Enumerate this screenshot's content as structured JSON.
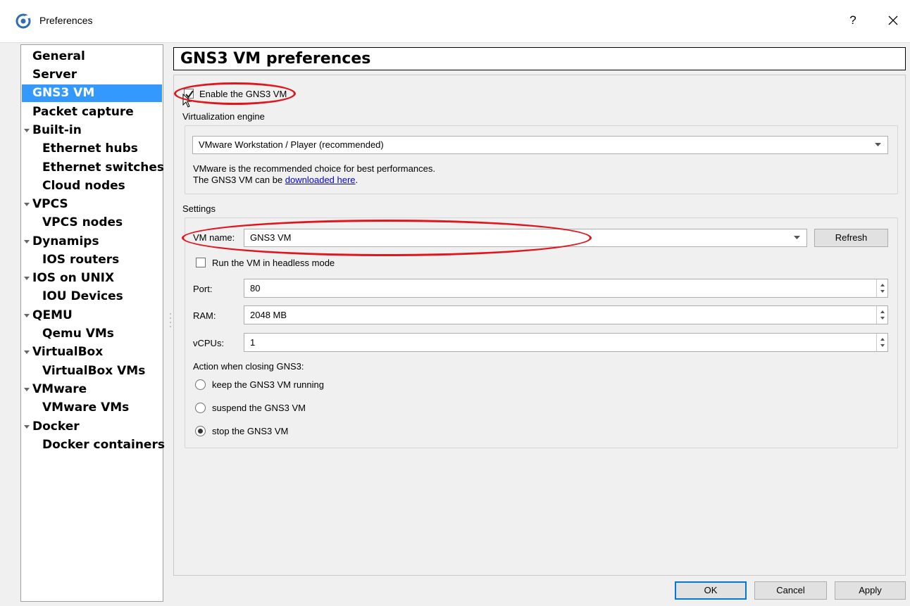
{
  "window": {
    "title": "Preferences",
    "help_label": "?",
    "icon": "gns3-app-icon",
    "close_icon": "close-icon"
  },
  "tree": {
    "items": [
      {
        "label": "General",
        "level": 0
      },
      {
        "label": "Server",
        "level": 0
      },
      {
        "label": "GNS3 VM",
        "level": 0,
        "selected": true
      },
      {
        "label": "Packet capture",
        "level": 0
      },
      {
        "label": "Built-in",
        "level": 0,
        "expanded": true
      },
      {
        "label": "Ethernet hubs",
        "level": 1
      },
      {
        "label": "Ethernet switches",
        "level": 1
      },
      {
        "label": "Cloud nodes",
        "level": 1
      },
      {
        "label": "VPCS",
        "level": 0,
        "expanded": true
      },
      {
        "label": "VPCS nodes",
        "level": 1
      },
      {
        "label": "Dynamips",
        "level": 0,
        "expanded": true
      },
      {
        "label": "IOS routers",
        "level": 1
      },
      {
        "label": "IOS on UNIX",
        "level": 0,
        "expanded": true
      },
      {
        "label": "IOU Devices",
        "level": 1
      },
      {
        "label": "QEMU",
        "level": 0,
        "expanded": true
      },
      {
        "label": "Qemu VMs",
        "level": 1
      },
      {
        "label": "VirtualBox",
        "level": 0,
        "expanded": true
      },
      {
        "label": "VirtualBox VMs",
        "level": 1
      },
      {
        "label": "VMware",
        "level": 0,
        "expanded": true
      },
      {
        "label": "VMware VMs",
        "level": 1
      },
      {
        "label": "Docker",
        "level": 0,
        "expanded": true
      },
      {
        "label": "Docker containers",
        "level": 1
      }
    ]
  },
  "page": {
    "title": "GNS3 VM preferences",
    "enable_label": "Enable the GNS3 VM",
    "enable_checked": true,
    "engine_group_label": "Virtualization engine",
    "engine_value": "VMware Workstation / Player (recommended)",
    "engine_note_line1": "VMware is the recommended choice for best performances.",
    "engine_note_line2_prefix": "The GNS3 VM can be ",
    "engine_note_link": "downloaded here",
    "engine_note_suffix": ".",
    "settings_group_label": "Settings",
    "vm_name_label": "VM name:",
    "vm_name_value": "GNS3 VM",
    "refresh_label": "Refresh",
    "headless_label": "Run the VM in headless mode",
    "headless_checked": false,
    "port_label": "Port:",
    "port_value": "80",
    "ram_label": "RAM:",
    "ram_value": "2048 MB",
    "vcpus_label": "vCPUs:",
    "vcpus_value": "1",
    "action_label": "Action when closing GNS3:",
    "action_options": [
      {
        "label": "keep the GNS3 VM running",
        "selected": false
      },
      {
        "label": "suspend the GNS3 VM",
        "selected": false
      },
      {
        "label": "stop the GNS3 VM",
        "selected": true
      }
    ]
  },
  "footer": {
    "ok_label": "OK",
    "cancel_label": "Cancel",
    "apply_label": "Apply"
  },
  "colors": {
    "selection": "#3399ff",
    "annotation": "#e0161e",
    "link": "#0000ee"
  }
}
